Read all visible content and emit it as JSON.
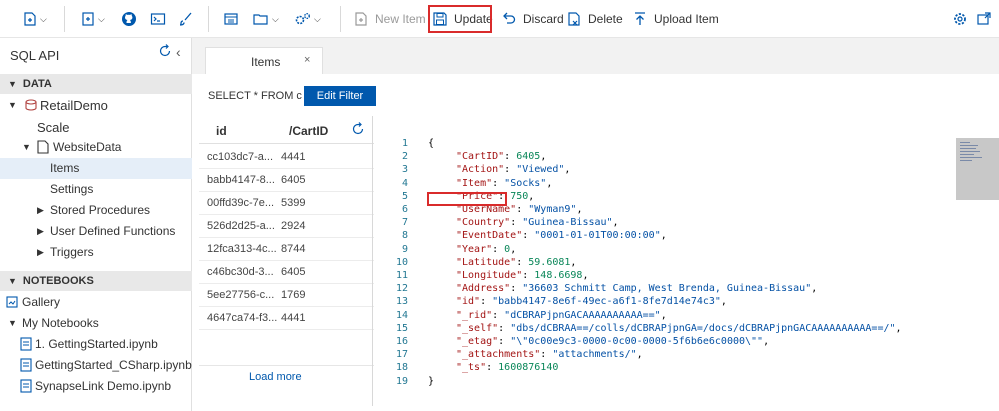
{
  "toolbar": {
    "new_item": "New Item",
    "update": "Update",
    "discard": "Discard",
    "delete": "Delete",
    "upload_item": "Upload Item"
  },
  "sidebar": {
    "title": "SQL API",
    "data_section": "DATA",
    "database": "RetailDemo",
    "scale": "Scale",
    "container": "WebsiteData",
    "items": "Items",
    "settings": "Settings",
    "stored_procedures": "Stored Procedures",
    "udfs": "User Defined Functions",
    "triggers": "Triggers",
    "notebooks_section": "NOTEBOOKS",
    "gallery": "Gallery",
    "my_notebooks": "My Notebooks",
    "notebooks": [
      "1. GettingStarted.ipynb",
      "GettingStarted_CSharp.ipynb",
      "SynapseLink Demo.ipynb"
    ]
  },
  "tab": {
    "label": "Items",
    "close": "×"
  },
  "query": {
    "text": "SELECT * FROM c",
    "filter_button": "Edit Filter"
  },
  "docs": {
    "col_id": "id",
    "col_cartid": "/CartID",
    "rows": [
      {
        "id": "cc103dc7-a...",
        "cart": "4441"
      },
      {
        "id": "babb4147-8...",
        "cart": "6405"
      },
      {
        "id": "00ffd39c-7e...",
        "cart": "5399"
      },
      {
        "id": "526d2d25-a...",
        "cart": "2924"
      },
      {
        "id": "12fca313-4c...",
        "cart": "8744"
      },
      {
        "id": "c46bc30d-3...",
        "cart": "6405"
      },
      {
        "id": "5ee27756-c...",
        "cart": "1769"
      },
      {
        "id": "4647ca74-f3...",
        "cart": "4441"
      }
    ],
    "load_more": "Load more"
  },
  "editor": {
    "line_numbers": [
      "1",
      "2",
      "3",
      "4",
      "5",
      "6",
      "7",
      "8",
      "9",
      "10",
      "11",
      "12",
      "13",
      "14",
      "15",
      "16",
      "17",
      "18",
      "19"
    ],
    "open_brace": "{",
    "close_brace": "}",
    "fields": [
      {
        "key": "\"CartID\"",
        "value": "6405",
        "kind": "n"
      },
      {
        "key": "\"Action\"",
        "value": "\"Viewed\"",
        "kind": "s"
      },
      {
        "key": "\"Item\"",
        "value": "\"Socks\"",
        "kind": "s"
      },
      {
        "key": "\"Price\"",
        "value": "750",
        "kind": "n"
      },
      {
        "key": "\"UserName\"",
        "value": "\"Wyman9\"",
        "kind": "s"
      },
      {
        "key": "\"Country\"",
        "value": "\"Guinea-Bissau\"",
        "kind": "s"
      },
      {
        "key": "\"EventDate\"",
        "value": "\"0001-01-01T00:00:00\"",
        "kind": "s"
      },
      {
        "key": "\"Year\"",
        "value": "0",
        "kind": "n"
      },
      {
        "key": "\"Latitude\"",
        "value": "59.6081",
        "kind": "n"
      },
      {
        "key": "\"Longitude\"",
        "value": "148.6698",
        "kind": "n"
      },
      {
        "key": "\"Address\"",
        "value": "\"36603 Schmitt Camp, West Brenda, Guinea-Bissau\"",
        "kind": "s"
      },
      {
        "key": "\"id\"",
        "value": "\"babb4147-8e6f-49ec-a6f1-8fe7d14e74c3\"",
        "kind": "s"
      },
      {
        "key": "\"_rid\"",
        "value": "\"dCBRAPjpnGACAAAAAAAAAA==\"",
        "kind": "s"
      },
      {
        "key": "\"_self\"",
        "value": "\"dbs/dCBRAA==/colls/dCBRAPjpnGA=/docs/dCBRAPjpnGACAAAAAAAAAA==/\"",
        "kind": "s"
      },
      {
        "key": "\"_etag\"",
        "value": "\"\\\"0c00e9c3-0000-0c00-0000-5f6b6e6c0000\\\"\"",
        "kind": "s"
      },
      {
        "key": "\"_attachments\"",
        "value": "\"attachments/\"",
        "kind": "s"
      },
      {
        "key": "\"_ts\"",
        "value": "1600876140",
        "kind": "n"
      }
    ]
  },
  "colors": {
    "accent": "#0058ad",
    "highlight": "#d92b2b",
    "selected": "#e5eef8"
  }
}
